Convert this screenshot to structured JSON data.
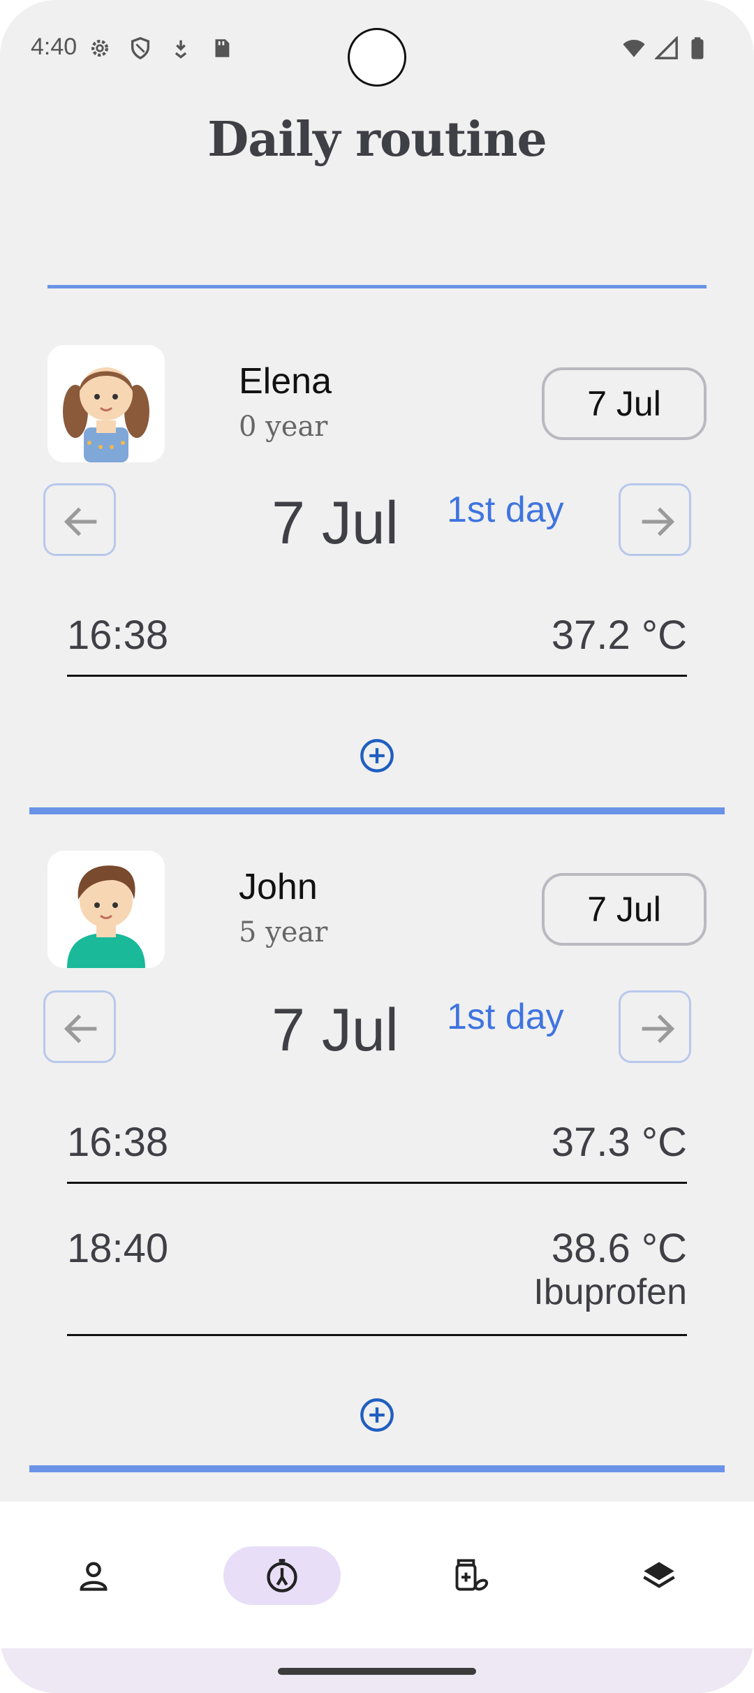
{
  "status_bar": {
    "time": "4:40"
  },
  "header": {
    "title": "Daily routine"
  },
  "children": [
    {
      "name": "Elena",
      "age": "0 year",
      "date_button": "7 Jul",
      "current_date": "7 Jul",
      "day_label": "1st day",
      "readings": [
        {
          "time": "16:38",
          "temp": "37.2 °C",
          "medicine": ""
        }
      ]
    },
    {
      "name": "John",
      "age": "5 year",
      "date_button": "7 Jul",
      "current_date": "7 Jul",
      "day_label": "1st day",
      "readings": [
        {
          "time": "16:38",
          "temp": "37.3 °C",
          "medicine": ""
        },
        {
          "time": "18:40",
          "temp": "38.6 °C",
          "medicine": "Ibuprofen"
        }
      ]
    }
  ],
  "bottom_nav": {
    "items": [
      {
        "icon": "person-icon",
        "active": false
      },
      {
        "icon": "stopwatch-icon",
        "active": true
      },
      {
        "icon": "medicine-icon",
        "active": false
      },
      {
        "icon": "layers-icon",
        "active": false
      }
    ]
  },
  "colors": {
    "accent": "#6a93e8",
    "day_label": "#3f74e0",
    "active_nav": "#e8def8",
    "add_icon": "#1f5fc0"
  }
}
